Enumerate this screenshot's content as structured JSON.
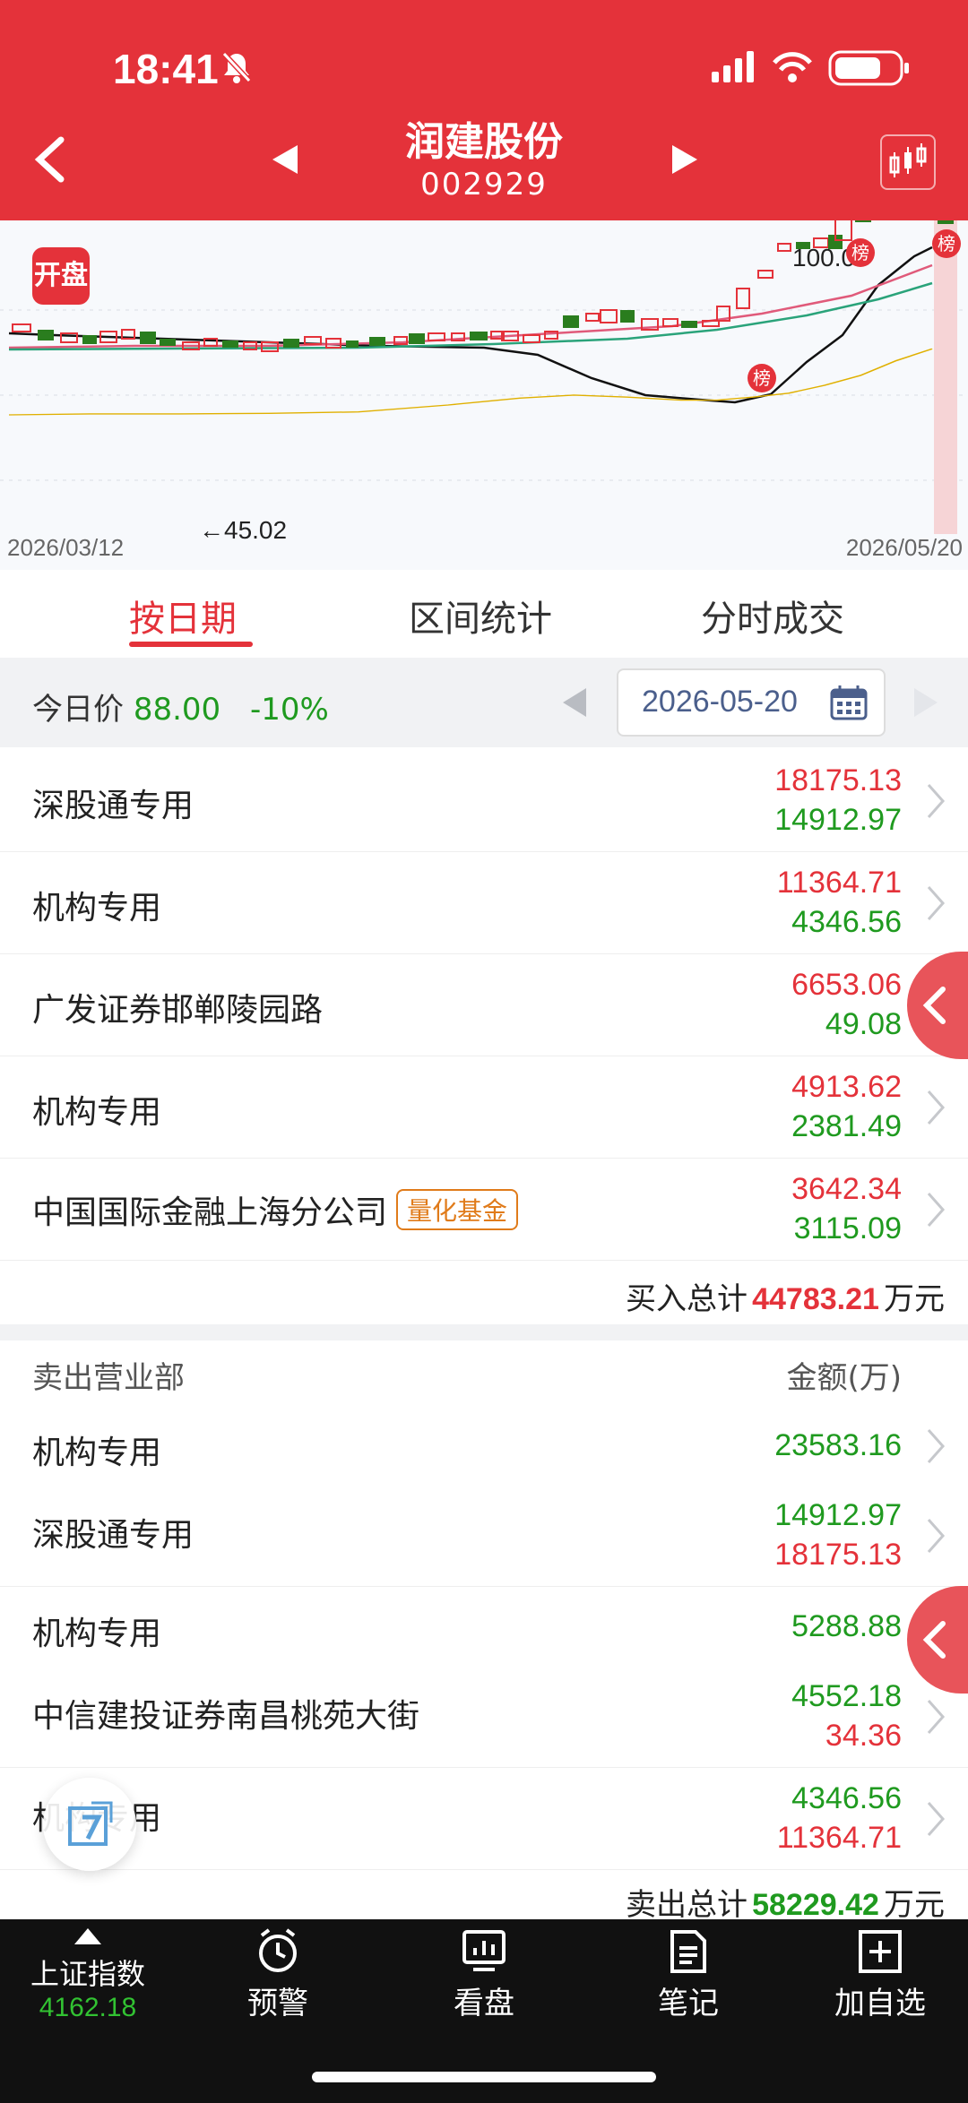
{
  "status": {
    "time": "18:41"
  },
  "header": {
    "title": "润建股份",
    "code": "002929"
  },
  "chart": {
    "badge": "开盘",
    "start_date": "2026/03/12",
    "end_date": "2026/05/20",
    "low_label": "←45.02",
    "high_label": "100.0",
    "rank_tag": "榜"
  },
  "tabs": [
    "按日期",
    "区间统计",
    "分时成交"
  ],
  "pricebar": {
    "label": "今日价",
    "price": "88.00",
    "change": "-10%",
    "date": "2026-05-20"
  },
  "buy_rows": [
    {
      "name": "深股通专用",
      "v1": "18175.13",
      "v2": "14912.97"
    },
    {
      "name": "机构专用",
      "v1": "11364.71",
      "v2": "4346.56"
    },
    {
      "name": "广发证券邯郸陵园路",
      "v1": "6653.06",
      "v2": "49.08"
    },
    {
      "name": "机构专用",
      "v1": "4913.62",
      "v2": "2381.49"
    },
    {
      "name": "中国国际金融上海分公司",
      "tag": "量化基金",
      "v1": "3642.34",
      "v2": "3115.09"
    }
  ],
  "buy_total": {
    "label": "买入总计",
    "value": "44783.21",
    "unit": "万元"
  },
  "sell_header": {
    "left": "卖出营业部",
    "right": "金额(万)"
  },
  "sell_rows": [
    {
      "name": "机构专用",
      "v1": "23583.16"
    },
    {
      "name": "深股通专用",
      "v1": "14912.97",
      "v2": "18175.13"
    },
    {
      "name": "机构专用",
      "v1": "5288.88"
    },
    {
      "name": "中信建投证券南昌桃苑大街",
      "v1": "4552.18",
      "v2": "34.36"
    },
    {
      "name": "机构专用",
      "v1": "4346.56",
      "v2": "11364.71"
    }
  ],
  "sell_total": {
    "label": "卖出总计",
    "value": "58229.42",
    "unit": "万元"
  },
  "tabbar": {
    "index_name": "上证指数",
    "index_value": "4162.18",
    "items": [
      "预警",
      "看盘",
      "笔记",
      "加自选"
    ]
  },
  "colors": {
    "red": "#e4323a",
    "green": "#1f9a1f"
  }
}
